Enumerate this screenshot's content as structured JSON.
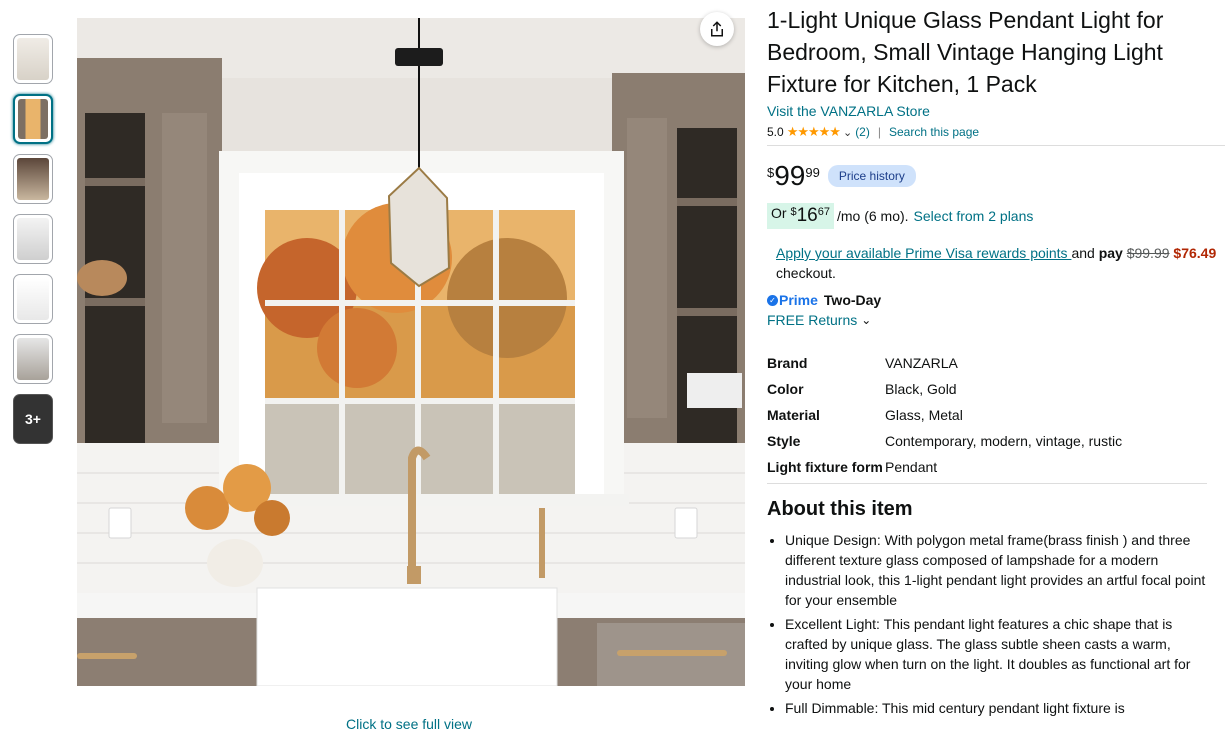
{
  "thumbnails": [
    {
      "label": ""
    },
    {
      "label": ""
    },
    {
      "label": ""
    },
    {
      "label": ""
    },
    {
      "label": ""
    },
    {
      "label": ""
    },
    {
      "label": "3+"
    }
  ],
  "gallery": {
    "full_view_label": "Click to see full view"
  },
  "product": {
    "title": "1-Light Unique Glass Pendant Light for Bedroom, Small Vintage Hanging Light Fixture for Kitchen, 1 Pack",
    "store_link": "Visit the VANZARLA Store",
    "rating": "5.0",
    "stars": "★★★★★",
    "review_count": "(2)",
    "search_page": "Search this page"
  },
  "pricing": {
    "currency": "$",
    "whole": "99",
    "fraction": "99",
    "price_history_label": "Price history",
    "monthly_prefix": "Or",
    "monthly_currency": "$",
    "monthly_whole": "16",
    "monthly_fraction": "67",
    "monthly_suffix": "/mo (6 mo).",
    "plans_link": "Select from 2 plans",
    "visa_link": "Apply your available Prime Visa rewards points ",
    "visa_and": "and",
    "visa_pay": "pay",
    "visa_old_price": "$99.99",
    "visa_new_price": "$76.49",
    "visa_checkout": "checkout."
  },
  "delivery": {
    "prime_label": "Prime",
    "two_day": "Two-Day",
    "returns": "FREE Returns"
  },
  "specs": [
    {
      "key": "Brand",
      "value": "VANZARLA"
    },
    {
      "key": "Color",
      "value": "Black, Gold"
    },
    {
      "key": "Material",
      "value": "Glass, Metal"
    },
    {
      "key": "Style",
      "value": "Contemporary, modern, vintage, rustic"
    },
    {
      "key": "Light fixture form",
      "value": "Pendant"
    }
  ],
  "about": {
    "heading": "About this item",
    "bullets": [
      "Unique Design: With polygon metal frame(brass finish ) and three different texture glass composed of lampshade for a modern industrial look, this 1-light pendant light provides an artful focal point for your ensemble",
      "Excellent Light: This pendant light features a chic shape that is crafted by unique glass. The glass subtle sheen casts a warm, inviting glow when turn on the light. It doubles as functional art for your home",
      "Full Dimmable: This mid century pendant light fixture is"
    ]
  },
  "colors": {
    "link": "#007185",
    "deal_red": "#B12704",
    "star": "#FF9900",
    "prime_blue": "#1a73e8"
  }
}
